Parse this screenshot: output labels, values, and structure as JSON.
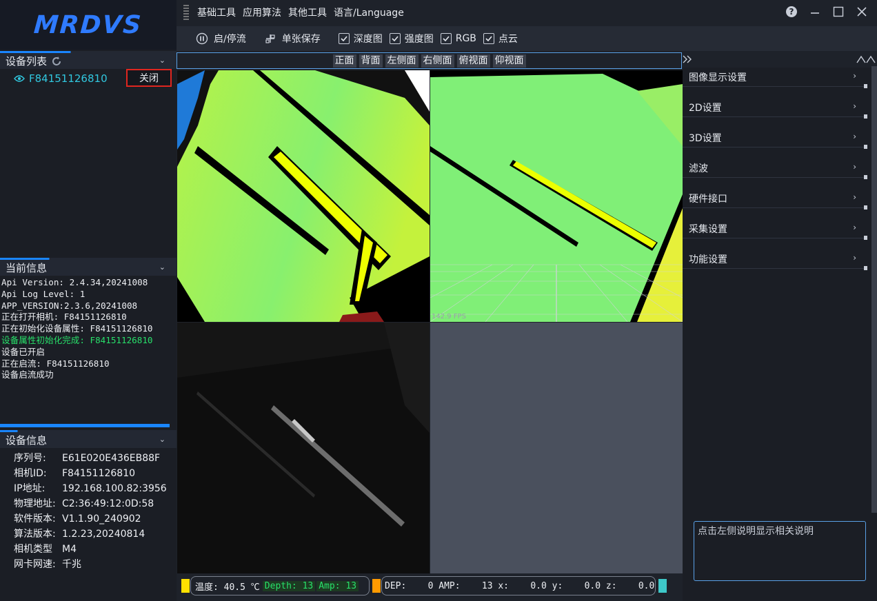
{
  "logo": "MRDVS",
  "menu": [
    "基础工具",
    "应用算法",
    "其他工具",
    "语言/Language"
  ],
  "toolbar": {
    "stream_toggle": "启/停流",
    "single_save": "单张保存",
    "checkboxes": [
      {
        "label": "深度图",
        "checked": true
      },
      {
        "label": "强度图",
        "checked": true
      },
      {
        "label": "RGB",
        "checked": true
      },
      {
        "label": "点云",
        "checked": true
      }
    ]
  },
  "views": [
    "正面",
    "背面",
    "左侧面",
    "右侧面",
    "俯视面",
    "仰视面"
  ],
  "device_list": {
    "title": "设备列表",
    "device_id": "F84151126810",
    "close_label": "关闭"
  },
  "current_info": {
    "title": "当前信息",
    "lines": [
      {
        "text": "Api Version: 2.4.34,20241008",
        "ok": false
      },
      {
        "text": "Api Log Level: 1",
        "ok": false
      },
      {
        "text": "APP_VERSION:2.3.6,20241008",
        "ok": false
      },
      {
        "text": "正在打开相机: F84151126810",
        "ok": false
      },
      {
        "text": "正在初始化设备属性: F84151126810",
        "ok": false
      },
      {
        "text": "设备属性初始化完成: F84151126810",
        "ok": true
      },
      {
        "text": "设备已开启",
        "ok": false
      },
      {
        "text": "正在启流: F84151126810",
        "ok": false
      },
      {
        "text": "设备启流成功",
        "ok": false
      }
    ]
  },
  "device_info": {
    "title": "设备信息",
    "rows": [
      {
        "k": "序列号:",
        "v": "E61E020E436EB88F"
      },
      {
        "k": "相机ID:",
        "v": "F84151126810"
      },
      {
        "k": "IP地址:",
        "v": "192.168.100.82:3956"
      },
      {
        "k": "物理地址:",
        "v": "C2:36:49:12:0D:58"
      },
      {
        "k": "软件版本:",
        "v": "V1.1.90_240902"
      },
      {
        "k": "算法版本:",
        "v": "1.2.23,20240814"
      },
      {
        "k": "相机类型",
        "v": "M4"
      },
      {
        "k": "网卡网速:",
        "v": "千兆"
      }
    ]
  },
  "settings": [
    "图像显示设置",
    "2D设置",
    "3D设置",
    "滤波",
    "硬件接口",
    "采集设置",
    "功能设置"
  ],
  "help_text": "点击左侧说明显示相关说明",
  "fps": "142.9 FPS",
  "status": {
    "temp_label": "温度: 40.5 ℃",
    "depth": "Depth: 13",
    "amp": "Amp: 13",
    "readout": "DEP:    0 AMP:    13 x:    0.0 y:    0.0 z:    0.0"
  },
  "colors": {
    "accent": "#1a86ff",
    "device_id": "#31c8e0",
    "ok_text": "#28e06a",
    "close_border": "#e0261f",
    "status_yellow": "#ffe100",
    "status_orange": "#ff9a00",
    "status_cyan": "#3ec8c8"
  }
}
